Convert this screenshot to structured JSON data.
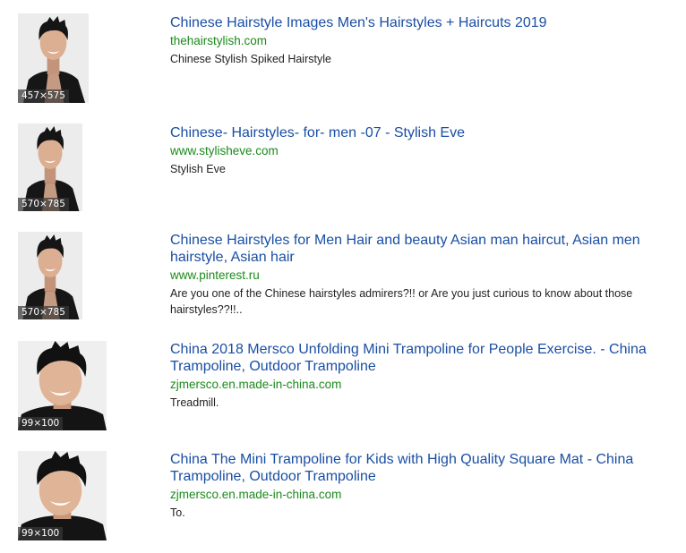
{
  "results": [
    {
      "title": "Chinese Hairstyle Images Men's Hairstyles + Haircuts 2019",
      "url": "thehairstylish.com",
      "snippet": "Chinese Stylish Spiked Hairstyle",
      "dimensions": "457×575"
    },
    {
      "title": "Chinese- Hairstyles- for- men -07 - Stylish Eve",
      "url": "www.stylisheve.com",
      "snippet": "Stylish Eve",
      "dimensions": "570×785"
    },
    {
      "title": "Chinese Hairstyles for Men Hair and beauty Asian man haircut, Asian men hairstyle, Asian hair",
      "url": "www.pinterest.ru",
      "snippet": "Are you one of the Chinese hairstyles admirers?!! or Are you just curious to know about those hairstyles??!!..",
      "dimensions": "570×785"
    },
    {
      "title": "China 2018 Mersco Unfolding Mini Trampoline for People Exercise. - China Trampoline, Outdoor Trampoline",
      "url": "zjmersco.en.made-in-china.com",
      "snippet": "Treadmill.",
      "dimensions": "99×100"
    },
    {
      "title": "China The Mini Trampoline for Kids with High Quality Square Mat - China Trampoline, Outdoor Trampoline",
      "url": "zjmersco.en.made-in-china.com",
      "snippet": "To.",
      "dimensions": "99×100"
    }
  ],
  "colors": {
    "title_link": "#1a4ea4",
    "url": "#1a8a1a",
    "snippet": "#222222"
  },
  "icons": {
    "thumbnail": "portrait-photo"
  }
}
